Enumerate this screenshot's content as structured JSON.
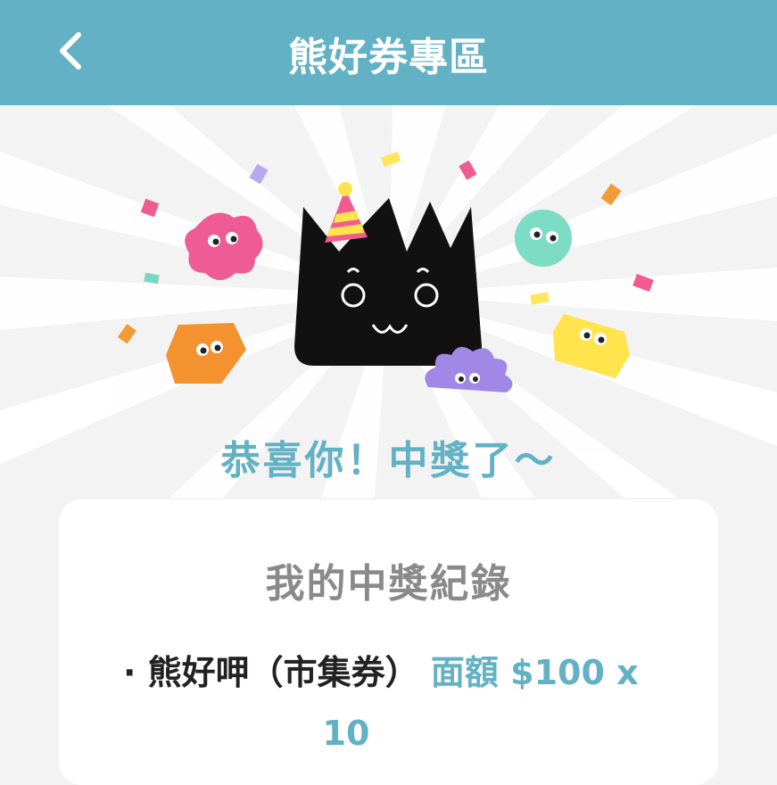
{
  "header": {
    "title": "熊好券專區",
    "back_icon": "chevron-left-icon"
  },
  "hero": {
    "illustration": "celebration-monsters-illustration",
    "congrats_text": "恭喜你！中獎了～"
  },
  "record_card": {
    "title": "我的中獎紀錄",
    "items": [
      {
        "bullet": "·",
        "name": "熊好呷（市集券）",
        "value_label": "面額 $100 x",
        "quantity": "10"
      }
    ]
  },
  "colors": {
    "brand": "#63b1c4",
    "background": "#f3f3f3",
    "card": "#ffffff"
  }
}
